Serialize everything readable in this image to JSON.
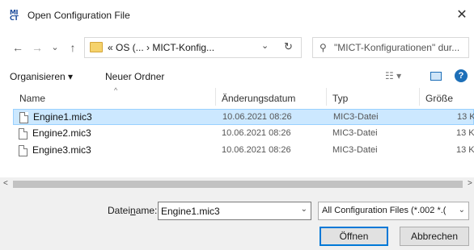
{
  "window": {
    "app_icon_text": "MI\nCT",
    "title": "Open Configuration File",
    "close_glyph": "✕"
  },
  "nav": {
    "back_glyph": "←",
    "forward_glyph": "→",
    "recent_glyph": "⌄",
    "up_glyph": "↑"
  },
  "address": {
    "path": "«  OS (...  ›  MICT-Konfig...",
    "dropdown_glyph": "⌄",
    "refresh_glyph": "↻"
  },
  "search": {
    "icon_glyph": "⚲",
    "placeholder": "\"MICT-Konfigurationen\" dur..."
  },
  "toolbar": {
    "organize_label": "Organisieren ▾",
    "new_folder_label": "Neuer Ordner",
    "view_glyph": "☷ ▾",
    "help_glyph": "?"
  },
  "columns": {
    "name": "Name",
    "date": "Änderungsdatum",
    "type": "Typ",
    "size": "Größe",
    "sort_glyph": "^"
  },
  "files": [
    {
      "name": "Engine1.mic3",
      "date": "10.06.2021 08:26",
      "type": "MIC3-Datei",
      "size": "13 K"
    },
    {
      "name": "Engine2.mic3",
      "date": "10.06.2021 08:26",
      "type": "MIC3-Datei",
      "size": "13 K"
    },
    {
      "name": "Engine3.mic3",
      "date": "10.06.2021 08:26",
      "type": "MIC3-Datei",
      "size": "13 K"
    }
  ],
  "scrollbar": {
    "left_glyph": "<",
    "right_glyph": ">"
  },
  "footer": {
    "filename_label_pre": "Datei",
    "filename_label_accel": "n",
    "filename_label_post": "ame:",
    "filename_value": "Engine1.mic3",
    "filename_dropdown_glyph": "⌄",
    "filter_value": "All Configuration Files (*.002 *.(",
    "filter_dropdown_glyph": "⌄",
    "open_label": "Öffnen",
    "cancel_label": "Abbrechen"
  }
}
